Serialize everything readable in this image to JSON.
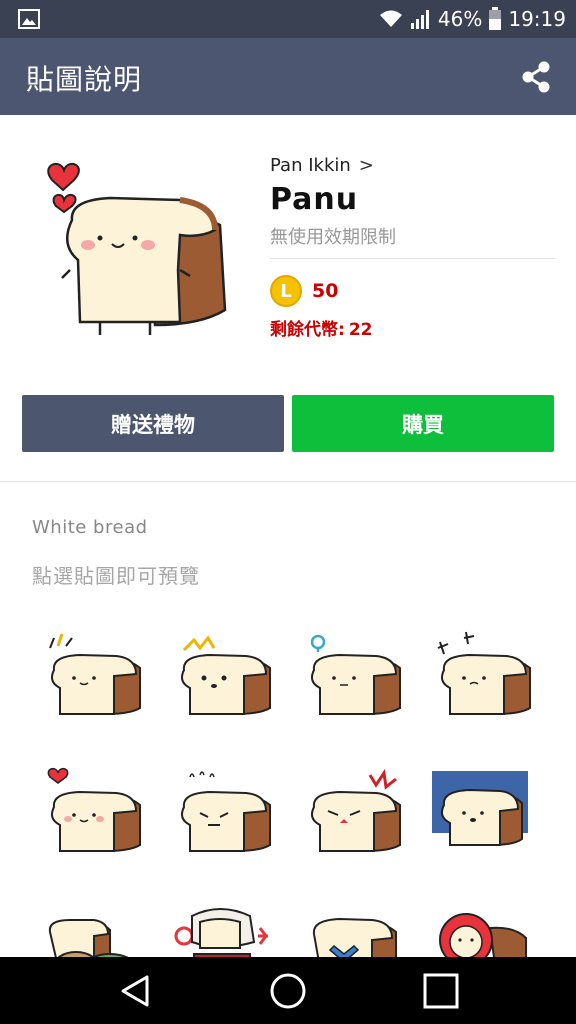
{
  "status_bar": {
    "battery_percent": "46%",
    "time": "19:19",
    "icons": [
      "image-icon",
      "wifi-icon",
      "signal-icon",
      "battery-icon"
    ]
  },
  "app_bar": {
    "title": "貼圖說明",
    "share_icon": "share-icon"
  },
  "product": {
    "author": "Pan Ikkin",
    "author_chevron": ">",
    "name": "Panu",
    "validity": "無使用效期限制",
    "price": "50",
    "coin_letter": "L",
    "remaining_label": "剩餘代幣:",
    "remaining_value": "22"
  },
  "buttons": {
    "gift": "贈送禮物",
    "buy": "購買"
  },
  "stickers": {
    "set_name": "White bread",
    "hint": "點選貼圖即可預覽"
  },
  "colors": {
    "status_bar": "#3a4152",
    "app_bar": "#4d5670",
    "gift_button": "#4c566e",
    "buy_button": "#0dbf3a",
    "price_red": "#cc0000"
  },
  "nav_bar": {
    "icons": [
      "back-icon",
      "home-icon",
      "recents-icon"
    ]
  }
}
